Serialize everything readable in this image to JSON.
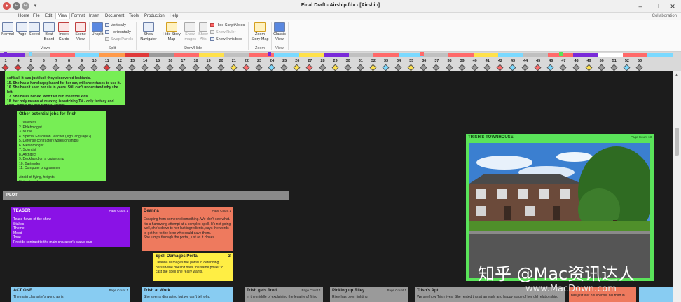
{
  "window": {
    "title": "Final Draft - Airship.fdx - [Airship]",
    "collaboration": "Collaboration"
  },
  "menu": [
    "Home",
    "File",
    "Edit",
    "View",
    "Format",
    "Insert",
    "Document",
    "Tools",
    "Production",
    "Help"
  ],
  "ribbon": {
    "views": {
      "normal": "Normal",
      "page": "Page",
      "speed": "Speed",
      "beat_board": "Beat Board",
      "index_cards": "Index Cards",
      "scene_view": "Scene View",
      "group": "Views"
    },
    "split": {
      "unsplit": "Unsplit",
      "vertically": "Vertically",
      "horizontally": "Horizontally",
      "swap_panels": "Swap Panels",
      "group": "Split"
    },
    "show_hide": {
      "show_navigator": "Show Navigator",
      "hide_story_map": "Hide Story Map",
      "show_images": "Show Images",
      "show_alts": "Show Alts",
      "hide_scriptnotes": "Hide ScriptNotes",
      "show_ruler": "Show Ruler",
      "show_invisibles": "Show Invisibles",
      "group": "Show/Hide"
    },
    "zoom": {
      "zoom_story_map": "Zoom Story Map",
      "group": "Zoom"
    },
    "view": {
      "classic_view": "Classic View",
      "group": "View"
    }
  },
  "page_numbers": [
    "1",
    "4",
    "5",
    "6",
    "7",
    "8",
    "9",
    "10",
    "11",
    "12",
    "13",
    "14",
    "15",
    "16",
    "17",
    "18",
    "19",
    "20",
    "21",
    "22",
    "23",
    "24",
    "25",
    "26",
    "27",
    "28",
    "29",
    "30",
    "31",
    "32",
    "33",
    "34",
    "35",
    "36",
    "37",
    "38",
    "39",
    "40",
    "41",
    "42",
    "43",
    "44",
    "45",
    "46",
    "47",
    "48",
    "49",
    "50",
    "51",
    "52",
    "53"
  ],
  "colors": {
    "green_card": "#77ee55",
    "purple_card": "#8a12e6",
    "salmon_card": "#ee7a5e",
    "yellow_card": "#ffee44",
    "blue_card": "#88ccf2",
    "gray_card": "#9a9a9a"
  },
  "cards": {
    "trish_notes": {
      "body": "softball. It was just luck they discovered lesbianis.\n15. She has a handicap placard for her car, will she refuses to use it.\n16. She hasn't seen her sis in years. Still can't understand why she left.\n17. She hates her ex. Won't let him meet the kids.\n18. Her only means of relaxing is watching TV - only fantasy and scifi. Junkie for bad fantasy shows."
    },
    "jobs": {
      "title": "Other potential jobs for Trish",
      "body": "1. Waitress\n2. Phlebologist\n3. Nurse\n4. Special Education Teacher (sign language?)\n5. Defense contractor (works on ships)\n6. Meteorologist\n7. Scientist\n8. Architect\n9. Deckhand on a cruise ship\n10. Bartender\n11. Computer programmer\n\nAfraid of flying, heights\nHates travel"
    },
    "plot": {
      "title": "PLOT"
    },
    "teaser": {
      "title": "TEASER",
      "page": "Page Count 1",
      "body": "Tease flavor of the show\nStakes\nTheme\nMood\nTone\nProvide contrast to the main character's status quo"
    },
    "deanna": {
      "title": "Deanna",
      "page": "Page Count 1",
      "body": "Escaping from someone/something. We don't see what.\nIt's a harrowing attempt at a complex spell. It's not going well, she's down to her last ingredients, says the words to get her to the here who could save them.\nShe jumps through the portal, just as it closes."
    },
    "spell": {
      "title": "Spell Damages Portal",
      "page": "3",
      "body": "Deanna damages the portal in defending herself-she doesn't have the same power to cast the spell she really wants."
    },
    "townhouse": {
      "title": "TRISH'S TOWNHOUSE",
      "page": "Page Count 13"
    },
    "act_one": {
      "title": "ACT ONE",
      "page": "Page Count 1",
      "body": "The main character's world as is"
    },
    "trish_work": {
      "title": "Trish at Work",
      "body": "She seems distracted but we can't tell why."
    },
    "trish_fired": {
      "title": "Trish gets fired",
      "page": "Page Count 1",
      "body": "In the middle of explaining the legality of firing"
    },
    "riley": {
      "title": "Picking up Riley",
      "page": "Page Count 1",
      "body": "Riley has been fighting"
    },
    "trish_apt": {
      "title": "Trish's Apt",
      "body": "We see how Trish lives. She rented this at an early and happy stage of her old relationship."
    },
    "salmon_cut": {
      "body": "has just lost his license. his third in ..."
    }
  },
  "watermark": {
    "line1": "知乎 @Mac资讯达人",
    "line2": "www.MacDown.com"
  }
}
